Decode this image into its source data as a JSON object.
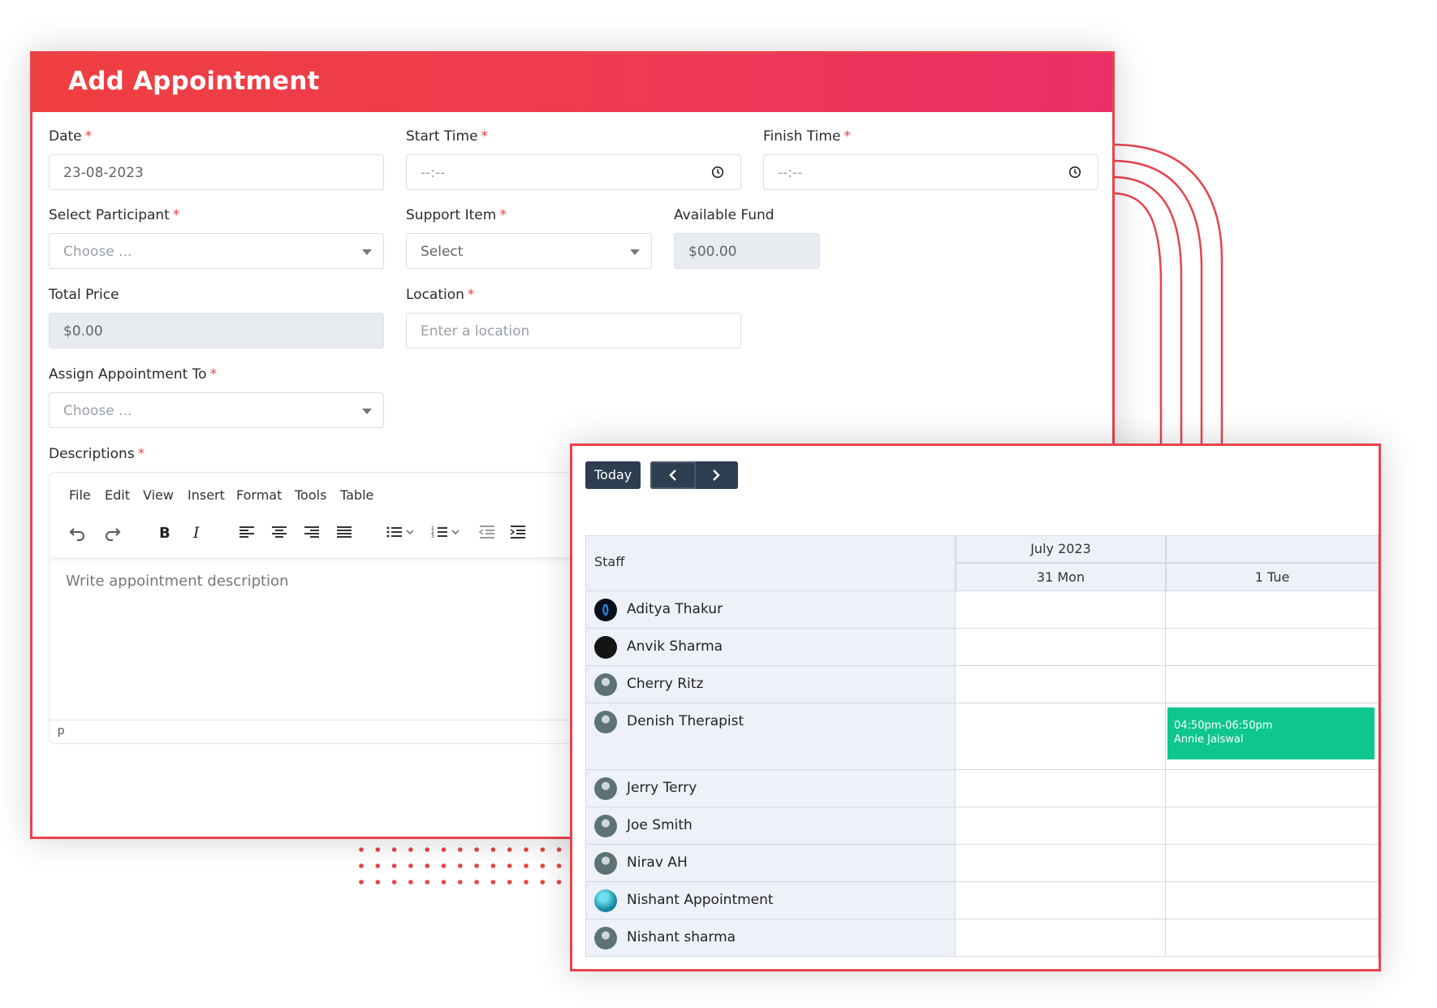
{
  "colors": {
    "accent": "#e8434d",
    "header_gradient_start": "#ef3f41",
    "header_gradient_end": "#ec2f69",
    "event": "#0ec68e",
    "dark_button": "#2c3e50"
  },
  "form": {
    "title": "Add Appointment",
    "required_mark": "*",
    "date": {
      "label": "Date",
      "value": "23-08-2023"
    },
    "start_time": {
      "label": "Start Time",
      "value": "--:--",
      "icon": "clock-icon"
    },
    "finish_time": {
      "label": "Finish Time",
      "value": "--:--",
      "icon": "clock-icon"
    },
    "participant": {
      "label": "Select Participant",
      "placeholder": "Choose ..."
    },
    "support_item": {
      "label": "Support Item",
      "placeholder": "Select"
    },
    "available_fund": {
      "label": "Available Fund",
      "value": "$00.00"
    },
    "total_price": {
      "label": "Total Price",
      "value": "$0.00"
    },
    "location": {
      "label": "Location",
      "placeholder": "Enter a location"
    },
    "assign_to": {
      "label": "Assign Appointment To",
      "placeholder": "Choose ..."
    },
    "descriptions": {
      "label": "Descriptions"
    }
  },
  "editor": {
    "menu": [
      "File",
      "Edit",
      "View",
      "Insert",
      "Format",
      "Tools",
      "Table"
    ],
    "toolbar_icons": [
      "undo-icon",
      "redo-icon",
      "bold-icon",
      "italic-icon",
      "align-left-icon",
      "align-center-icon",
      "align-right-icon",
      "align-justify-icon",
      "bullet-list-icon",
      "numbered-list-icon",
      "outdent-icon",
      "indent-icon"
    ],
    "placeholder": "Write appointment description",
    "status_path": "p"
  },
  "calendar": {
    "today_label": "Today",
    "staff_header": "Staff",
    "month_label": "July 2023",
    "days": [
      "31  Mon",
      "1  Tue"
    ],
    "staff": [
      "Aditya Thakur",
      "Anvik Sharma",
      "Cherry Ritz",
      "Denish Therapist",
      "Jerry Terry",
      "Joe Smith",
      "Nirav AH",
      "Nishant Appointment",
      "Nishant sharma"
    ],
    "event": {
      "staff": "Denish Therapist",
      "day": "1  Tue",
      "time": "04:50pm-06:50pm",
      "client": "Annie Jaiswal"
    }
  }
}
